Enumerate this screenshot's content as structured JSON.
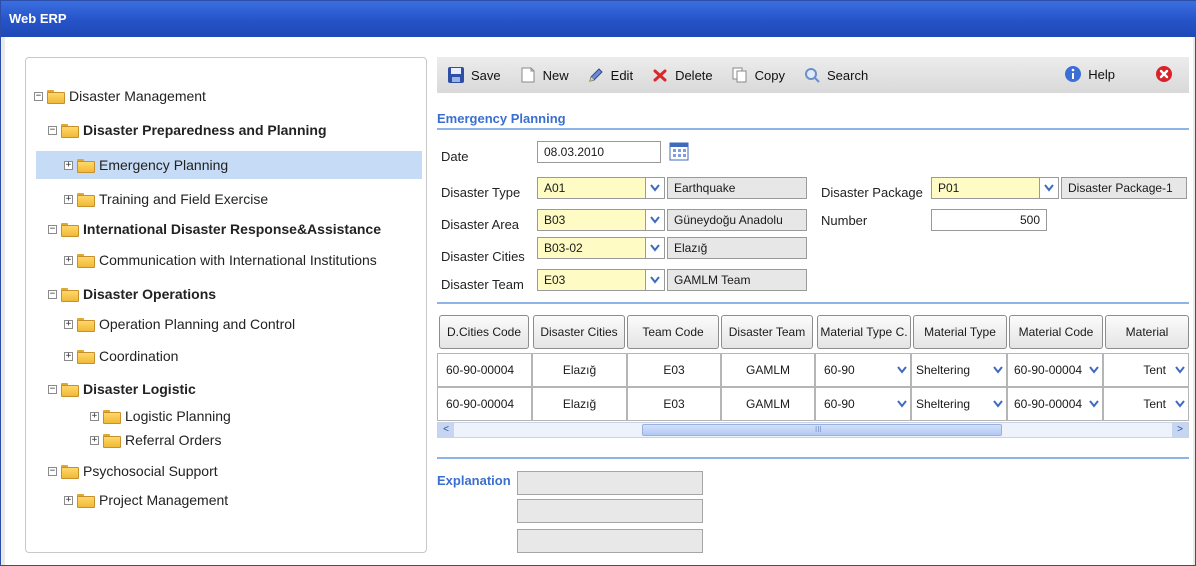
{
  "window": {
    "title": "Web ERP"
  },
  "tree": [
    {
      "label": "Disaster Management",
      "bold": false,
      "expanded": true
    },
    {
      "label": "Disaster Preparedness and Planning",
      "bold": true,
      "expanded": true
    },
    {
      "label": "Emergency Planning",
      "bold": false,
      "expanded": false,
      "selected": true
    },
    {
      "label": "Training and Field Exercise",
      "bold": false,
      "expanded": false
    },
    {
      "label": "International Disaster Response&Assistance",
      "bold": true,
      "expanded": true
    },
    {
      "label": "Communication with International Institutions",
      "bold": false,
      "expanded": false
    },
    {
      "label": "Disaster Operations",
      "bold": true,
      "expanded": true
    },
    {
      "label": "Operation Planning and Control",
      "bold": false,
      "expanded": false
    },
    {
      "label": "Coordination",
      "bold": false,
      "expanded": false
    },
    {
      "label": "Disaster Logistic",
      "bold": true,
      "expanded": true
    },
    {
      "label": "Logistic Planning",
      "bold": false,
      "expanded": false
    },
    {
      "label": "Referral Orders",
      "bold": false,
      "expanded": false
    },
    {
      "label": "Psychosocial Support",
      "bold": false,
      "expanded": true
    },
    {
      "label": "Project Management",
      "bold": false,
      "expanded": false
    }
  ],
  "toolbar": {
    "save": "Save",
    "new": "New",
    "edit": "Edit",
    "delete": "Delete",
    "copy": "Copy",
    "search": "Search",
    "help": "Help"
  },
  "form": {
    "section_title": "Emergency Planning",
    "date": {
      "label": "Date",
      "value": "08.03.2010"
    },
    "disaster_type": {
      "label": "Disaster Type",
      "code": "A01",
      "name": "Earthquake"
    },
    "disaster_area": {
      "label": "Disaster Area",
      "code": "B03",
      "name": "Güneydoğu Anadolu"
    },
    "disaster_cities": {
      "label": "Disaster Cities",
      "code": "B03-02",
      "name": "Elazığ"
    },
    "disaster_team": {
      "label": "Disaster Team",
      "code": "E03",
      "name": "GAMLM Team"
    },
    "disaster_package": {
      "label": "Disaster Package",
      "code": "P01",
      "name": "Disaster Package-1"
    },
    "number": {
      "label": "Number",
      "value": "500"
    }
  },
  "grid": {
    "columns": [
      "D.Cities Code",
      "Disaster Cities",
      "Team Code",
      "Disaster Team",
      "Material Type C.",
      "Material Type",
      "Material Code",
      "Material"
    ],
    "rows": [
      [
        "60-90-00004",
        "Elazığ",
        "E03",
        "GAMLM",
        "60-90",
        "Sheltering",
        "60-90-00004",
        "Tent"
      ],
      [
        "60-90-00004",
        "Elazığ",
        "E03",
        "GAMLM",
        "60-90",
        "Sheltering",
        "60-90-00004",
        "Tent"
      ]
    ],
    "scroll": {
      "left_arrow": "<",
      "right_arrow": ">",
      "thumb_grip": "III"
    }
  },
  "explanation": {
    "label": "Explanation"
  },
  "colors": {
    "accent": "#3a6fd0",
    "required": "#fefcc4",
    "titlebar": "#2553c8"
  }
}
